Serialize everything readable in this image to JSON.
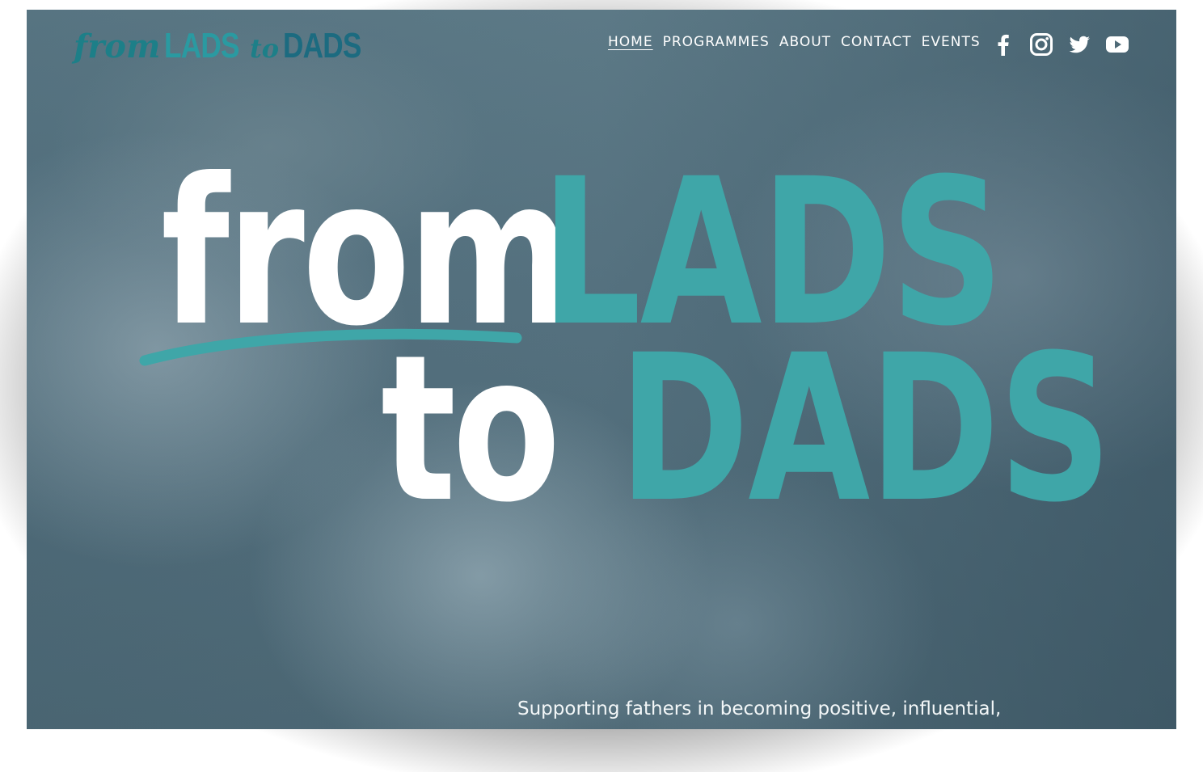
{
  "brand": {
    "logo": {
      "w1": "from",
      "w2": "LADS",
      "w3": "to",
      "w4": "DADS"
    }
  },
  "nav": {
    "items": [
      {
        "label": "HOME",
        "active": true
      },
      {
        "label": "PROGRAMMES",
        "active": false
      },
      {
        "label": "ABOUT",
        "active": false
      },
      {
        "label": "CONTACT",
        "active": false
      },
      {
        "label": "EVENTS",
        "active": false
      }
    ]
  },
  "social": [
    "facebook-icon",
    "instagram-icon",
    "twitter-icon",
    "youtube-icon"
  ],
  "hero": {
    "line1_a": "from",
    "line1_b": "LADS",
    "line2_a": "to",
    "line2_b": "DADS",
    "tagline": "Supporting fathers in becoming positive, influential, active role models in their children’s lives"
  },
  "colors": {
    "accent": "#3fa6a8",
    "logo_dark": "#1c6b80",
    "text": "#ffffff"
  }
}
